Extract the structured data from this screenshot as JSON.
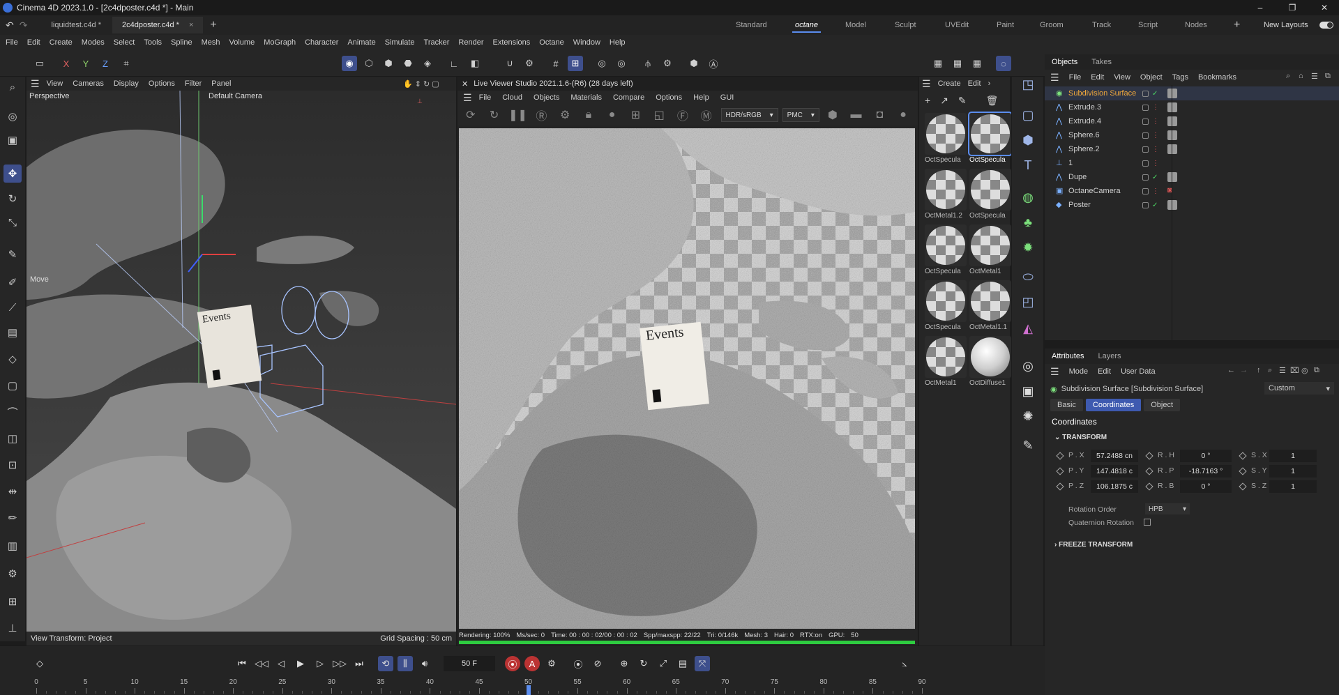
{
  "window": {
    "title": "Cinema 4D 2023.1.0 - [2c4dposter.c4d *] - Main",
    "controls": [
      "–",
      "❐",
      "✕"
    ]
  },
  "tabs": {
    "documents": [
      {
        "label": "liquidtest.c4d *"
      },
      {
        "label": "2c4dposter.c4d *",
        "close": "×"
      }
    ],
    "add": "+",
    "layouts": [
      "Standard",
      "octane",
      "Model",
      "Sculpt",
      "UVEdit",
      "Paint",
      "Groom",
      "Track",
      "Script",
      "Nodes"
    ],
    "new_layouts": "New Layouts"
  },
  "menu": [
    "File",
    "Edit",
    "Create",
    "Modes",
    "Select",
    "Tools",
    "Spline",
    "Mesh",
    "Volume",
    "MoGraph",
    "Character",
    "Animate",
    "Simulate",
    "Tracker",
    "Render",
    "Extensions",
    "Octane",
    "Window",
    "Help"
  ],
  "toolbar": {
    "axis_x": "X",
    "axis_y": "Y",
    "axis_z": "Z"
  },
  "viewport": {
    "menu": [
      "View",
      "Cameras",
      "Display",
      "Options",
      "Filter",
      "Panel"
    ],
    "projection": "Perspective",
    "camera": "Default Camera",
    "tool": "Move",
    "view_transform": "View Transform: Project",
    "grid_spacing": "Grid Spacing : 50 cm",
    "poster_text": "Events"
  },
  "live_viewer": {
    "title": "Live Viewer Studio 2021.1.6-(R6) (28 days left)",
    "menu": [
      "File",
      "Cloud",
      "Objects",
      "Materials",
      "Compare",
      "Options",
      "Help",
      "GUI"
    ],
    "colorspace": "HDR/sRGB",
    "mode": "PMC",
    "poster_text": "Events",
    "stats": {
      "rendering": "Rendering: 100%",
      "ms_sec": "Ms/sec: 0",
      "time": "Time: 00 : 00 : 02/00 : 00 : 02",
      "spp": "Spp/maxspp: 22/22",
      "tri": "Tri: 0/146k",
      "mesh": "Mesh: 3",
      "hair": "Hair: 0",
      "rtx": "RTX:on",
      "gpu": "GPU:",
      "gpu_val": "50"
    },
    "progress": 1.0
  },
  "materials": {
    "menu": [
      "Create",
      "Edit",
      "›"
    ],
    "items": [
      {
        "label": "OctSpecula",
        "kind": "checker"
      },
      {
        "label": "OctSpecula",
        "kind": "checker",
        "selected": true
      },
      {
        "label": "OctMetal1.2",
        "kind": "checker"
      },
      {
        "label": "OctSpecula",
        "kind": "checker"
      },
      {
        "label": "OctSpecula",
        "kind": "checker"
      },
      {
        "label": "OctMetal1",
        "kind": "checker"
      },
      {
        "label": "OctSpecula",
        "kind": "checker"
      },
      {
        "label": "OctMetal1.1",
        "kind": "checker"
      },
      {
        "label": "OctMetal1",
        "kind": "checker"
      },
      {
        "label": "OctDiffuse1",
        "kind": "diffuse"
      }
    ]
  },
  "objects_panel": {
    "tabs": [
      "Objects",
      "Takes"
    ],
    "menu": [
      "File",
      "Edit",
      "View",
      "Object",
      "Tags",
      "Bookmarks"
    ],
    "rows": [
      {
        "name": "Subdivision Surface",
        "icon": "subdivision-icon",
        "selected": true
      },
      {
        "name": "Extrude.3",
        "icon": "extrude-icon"
      },
      {
        "name": "Extrude.4",
        "icon": "extrude-icon"
      },
      {
        "name": "Sphere.6",
        "icon": "sphere-icon"
      },
      {
        "name": "Sphere.2",
        "icon": "sphere-icon"
      },
      {
        "name": "1",
        "icon": "null-icon"
      },
      {
        "name": "Dupe",
        "icon": "sphere-icon"
      },
      {
        "name": "OctaneCamera",
        "icon": "camera-icon"
      },
      {
        "name": "Poster",
        "icon": "plane-icon"
      }
    ]
  },
  "attributes": {
    "tabs": [
      "Attributes",
      "Layers"
    ],
    "menu": [
      "Mode",
      "Edit",
      "User Data"
    ],
    "object_title": "Subdivision Surface [Subdivision Surface]",
    "preset": "Custom",
    "subtabs": [
      "Basic",
      "Coordinates",
      "Object"
    ],
    "active_subtab": "Coordinates",
    "section": "Coordinates",
    "group_transform": "TRANSFORM",
    "group_freeze": "FREEZE TRANSFORM",
    "pos": [
      {
        "label": "P . X",
        "value": "57.2488 cn"
      },
      {
        "label": "P . Y",
        "value": "147.4818 c"
      },
      {
        "label": "P . Z",
        "value": "106.1875 c"
      }
    ],
    "rot": [
      {
        "label": "R . H",
        "value": "0 °"
      },
      {
        "label": "R . P",
        "value": "-18.7163 °"
      },
      {
        "label": "R . B",
        "value": "0 °"
      }
    ],
    "scale": [
      {
        "label": "S . X",
        "value": "1"
      },
      {
        "label": "S . Y",
        "value": "1"
      },
      {
        "label": "S . Z",
        "value": "1"
      }
    ],
    "rotation_order_label": "Rotation Order",
    "rotation_order": "HPB",
    "quaternion_label": "Quaternion Rotation"
  },
  "timeline": {
    "current_frame": "50 F",
    "ticks": [
      "0",
      "5",
      "10",
      "15",
      "20",
      "25",
      "30",
      "35",
      "40",
      "45",
      "50",
      "55",
      "60",
      "65",
      "70",
      "75",
      "80",
      "85",
      "90"
    ],
    "playhead_frame": 50,
    "range_end": 90
  },
  "colors": {
    "accent": "#5b8def",
    "selected_object": "#f2a93b",
    "progress": "#2ecc40"
  }
}
